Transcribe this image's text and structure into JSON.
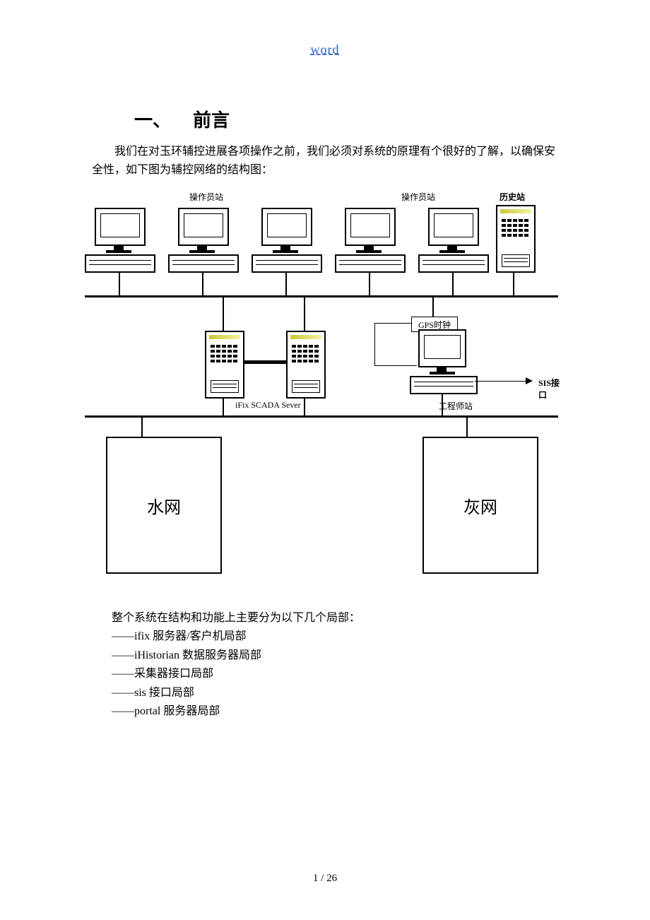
{
  "header": {
    "link_text": "word"
  },
  "heading": {
    "number": "一、",
    "title": "前言"
  },
  "body": {
    "paragraph": "　　我们在对玉环辅控进展各项操作之前，我们必须对系统的原理有个很好的了解，以确保安全性，如下图为辅控网络的结构图："
  },
  "diagram": {
    "label_operator_left": "操作员站",
    "label_operator_right": "操作员站",
    "label_history": "历史站",
    "label_scada": "iFix SCADA Sever",
    "label_gps": "GPS时钟",
    "label_engineer": "工程师站",
    "label_sis": "SIS接口",
    "box_water": "水网",
    "box_ash": "灰网"
  },
  "list": {
    "intro": "整个系统在结构和功能上主要分为以下几个局部：",
    "items": [
      "——ifix 服务器/客户机局部",
      "——iHistorian 数据服务器局部",
      "——采集器接口局部",
      "——sis 接口局部",
      "——portal 服务器局部"
    ]
  },
  "footer": {
    "page": "1 / 26"
  }
}
